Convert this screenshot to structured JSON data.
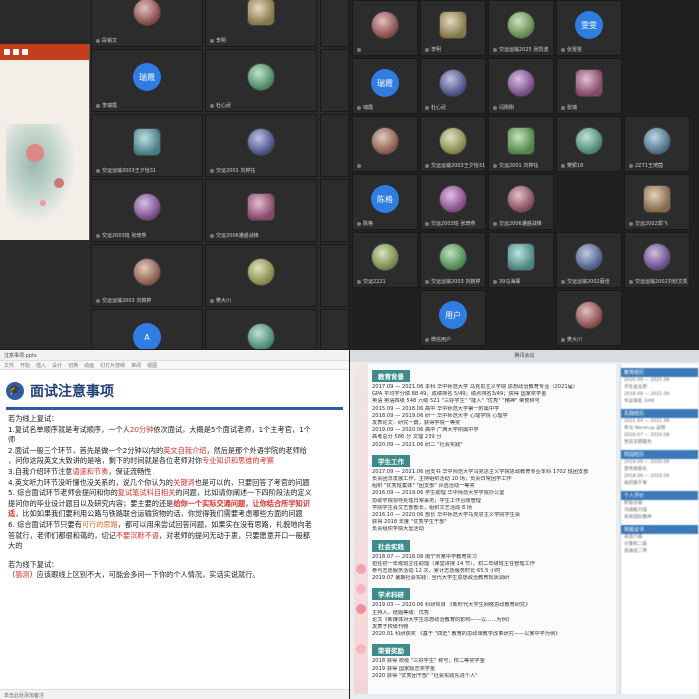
{
  "tl": {
    "tiles": [
      {
        "name": "段锡文",
        "avatar": "",
        "col": 1,
        "row": 0
      },
      {
        "name": "李明",
        "avatar": "",
        "col": 2,
        "row": 0
      },
      {
        "name": "李瑞霞",
        "avatar": "瑞霞",
        "col": 1,
        "row": 1
      },
      {
        "name": "杜心武",
        "avatar": "",
        "col": 2,
        "row": 1
      },
      {
        "name": "交运运输2003王夕怡31",
        "avatar": "",
        "col": 1,
        "row": 2
      },
      {
        "name": "交运2001 刘婷钰",
        "avatar": "",
        "col": 2,
        "row": 2
      },
      {
        "name": "交运2003班 张琦燕",
        "avatar": "",
        "col": 1,
        "row": 3
      },
      {
        "name": "交运2006潘盛战锋",
        "avatar": "",
        "col": 2,
        "row": 3
      },
      {
        "name": "交运运输2003 刘婉婷",
        "avatar": "",
        "col": 1,
        "row": 4
      },
      {
        "name": "樊大川",
        "avatar": "",
        "col": 2,
        "row": 4
      },
      {
        "name": "andes",
        "avatar": "A",
        "col": 1,
        "row": 5
      },
      {
        "name": "35刘丽琴",
        "avatar": "",
        "col": 2,
        "row": 5
      }
    ],
    "right_col": [
      "",
      "",
      "",
      "",
      "",
      ""
    ]
  },
  "tr": {
    "tiles": [
      {
        "name": "",
        "avatar": "",
        "col": 0,
        "row": 0
      },
      {
        "name": "李明",
        "avatar": "",
        "col": 1,
        "row": 0
      },
      {
        "name": "交运运输2025 张凯波",
        "avatar": "",
        "col": 2,
        "row": 0
      },
      {
        "name": "张雯雯",
        "avatar": "雯雯",
        "col": 3,
        "row": 0
      },
      {
        "name": "瑞霞",
        "avatar": "瑞霞",
        "col": 0,
        "row": 1
      },
      {
        "name": "杜心武",
        "avatar": "",
        "col": 1,
        "row": 1
      },
      {
        "name": "闫刚刚",
        "avatar": "",
        "col": 2,
        "row": 1
      },
      {
        "name": "张瑞",
        "avatar": "",
        "col": 3,
        "row": 1
      },
      {
        "name": "",
        "avatar": "",
        "col": 0,
        "row": 2
      },
      {
        "name": "交运运输2003王夕怡31",
        "avatar": "",
        "col": 1,
        "row": 2
      },
      {
        "name": "交运2001 刘婷钰",
        "avatar": "",
        "col": 2,
        "row": 2
      },
      {
        "name": "樊颖18",
        "avatar": "",
        "col": 3,
        "row": 2
      },
      {
        "name": "2Z71王琦茵",
        "avatar": "",
        "col": 4,
        "row": 2
      },
      {
        "name": "陈格",
        "avatar": "陈格",
        "col": 0,
        "row": 3
      },
      {
        "name": "交运2003班 张琦燕",
        "avatar": "",
        "col": 1,
        "row": 3
      },
      {
        "name": "交运2006潘盛战锋",
        "avatar": "",
        "col": 2,
        "row": 3
      },
      {
        "name": "交运2002郭飞",
        "avatar": "",
        "col": 4,
        "row": 3
      },
      {
        "name": "交运2221",
        "avatar": "",
        "col": 0,
        "row": 4
      },
      {
        "name": "交运运输2003 刘婉婷",
        "avatar": "",
        "col": 1,
        "row": 4
      },
      {
        "name": "39马海褰",
        "avatar": "",
        "col": 2,
        "row": 4
      },
      {
        "name": "交运运输2002蔡佳",
        "avatar": "",
        "col": 3,
        "row": 4
      },
      {
        "name": "交运运输2002刘欣文凯",
        "avatar": "",
        "col": 4,
        "row": 4
      },
      {
        "name": "微信用户",
        "avatar": "用户",
        "col": 1,
        "row": 5
      },
      {
        "name": "樊大川",
        "avatar": "",
        "col": 3,
        "row": 5
      }
    ]
  },
  "bl": {
    "file_name": "注意事项.pptx",
    "ribbon": [
      "文件",
      "开始",
      "插入",
      "设计",
      "切换",
      "动画",
      "幻灯片放映",
      "审阅",
      "视图"
    ],
    "title": "面试注意事项",
    "online_heading": "若为线上复试：",
    "lines": [
      {
        "parts": [
          [
            "1.复试名单顺序就是考试顺序，一个人",
            ""
          ],
          [
            "20分钟",
            "red"
          ],
          [
            "依次面试，大概是5个面试老师，1个主考官，1个",
            ""
          ]
        ]
      },
      {
        "parts": [
          [
            "师",
            ""
          ]
        ]
      },
      {
        "parts": [
          [
            "2.面试一般三个环节，首先是做一个2分钟以内的",
            ""
          ],
          [
            "英文自我介绍",
            "red"
          ],
          [
            "，然后是那个外语学院的老师给",
            ""
          ]
        ]
      },
      {
        "parts": [
          [
            "，问你这段英文大致讲的是啥，剩下的时间就是各位老师对你",
            ""
          ],
          [
            "专业知识和思维的考察",
            "red"
          ]
        ]
      },
      {
        "parts": [
          [
            "3.自我介绍环节注意",
            ""
          ],
          [
            "语速和节奏",
            "red"
          ],
          [
            "，保证流畅性",
            ""
          ]
        ]
      },
      {
        "parts": [
          [
            "4.英文听力环节没听懂也没关系的，说几个你认为的",
            ""
          ],
          [
            "关键词",
            "red"
          ],
          [
            "也是可以的，只要回答了考官的问题",
            ""
          ]
        ]
      },
      {
        "parts": [
          [
            "5. 综合面试环节老师会提问和你的",
            ""
          ],
          [
            "复试笔试科目相关",
            "red"
          ],
          [
            "的问题，比如请你阐述一下四阶段法的定义",
            ""
          ]
        ]
      },
      {
        "parts": [
          [
            "提问你的毕业设计题目以及研究内容；要主要的还是",
            ""
          ],
          [
            "给你一个实际交通问题，让你结合所学知识",
            "red bold"
          ]
        ]
      },
      {
        "parts": [
          [
            "适",
            "red bold"
          ],
          [
            "，比如如果我们要利用公路与铁路联合运输货物的话，你觉得我们需要考虑哪些方面的问题",
            ""
          ]
        ]
      },
      {
        "parts": [
          [
            "6. 综合面试环节只要有",
            ""
          ],
          [
            "可行的思路",
            "org"
          ],
          [
            "，都可以用来尝试回答问题，如果实在没有思路，礼貌地向老",
            ""
          ]
        ]
      },
      {
        "parts": [
          [
            "答就行，老师们都很和蔼的，切记",
            ""
          ],
          [
            "不要沉默不语",
            "red"
          ],
          [
            "，对老师的提问无动于衷，只要愿意开口一般都",
            ""
          ]
        ]
      },
      {
        "parts": [
          [
            "大的",
            ""
          ]
        ]
      }
    ],
    "offline_heading": "若为线下复试：",
    "offline_line": [
      [
        "（",
        ""
      ],
      [
        "猜测",
        "red"
      ],
      [
        "）应该跟线上区别不大，可能会多问一下你的个人情况，实话实说就行。",
        ""
      ]
    ],
    "footer": "单击此处添加备注"
  },
  "br": {
    "window_title": "腾讯会议",
    "sections": [
      {
        "heading": "教育背景",
        "lines": [
          "2017.09 — 2021.06  本科  华中师范大学  马克思主义学院  思想政治教育专业（2021届）",
          "GPA  平均学分绩 88.49，成绩排名 5/49；绩点排名3/49；获得 国家奖学金",
          "英语  英语四级 548 六级 521  \"三好学生\"  \"能人\"  \"优秀\"  \"精神\" 荣誉称号",
          "2015.09 — 2018.06  高中  华中师范大学第一附属中学",
          "2018.09 — 2019.06  研一  华中师范大学  心理学院  心理学",
          "  发表论文：研究一篇，获得学院一等奖",
          "2019.09 — 2020.06  高中  广西大学附属中学",
          "  高考总分 586 分  文理 239 分",
          "2020.09 — 2021.06  研二  \"社会实践\""
        ]
      },
      {
        "heading": "学生工作",
        "lines": [
          "2017.09 — 2021.06  团支书  华中师范大学马克思主义学院思政教育专业本科 1702 班团支部",
          "  负责团员发展工作，主持组织活动 10 场；负责日常团学工作",
          "  组织 \"优秀班集体\"  \"团支部\" 评选活动一等奖",
          "2016.09 — 2019.06  学生助理  华中师范大学学院办公室",
          "  协助学院领导处理日常事务；学生工作台账管理",
          "  学院学生会文艺部部长，组织文艺活动 8 场",
          "2016.10 — 2020.06  部长  华中师范大学马克思主义学院学生会",
          "  获得 2018 年度 \"优秀学生干部\"",
          "  负责组织学院大型活动"
        ]
      },
      {
        "heading": "社会实践",
        "lines": [
          "2018.07 — 2018.08  南宁市某中学教育实习",
          "  担任初一年级班主任助理（课堂讲授 14 节），初二年级班主任管理工作",
          "  参与志愿服务活动 12 次，累计志愿服务时长 65.5 小时",
          "2019.07  暑期社会实践：当代大学生思想政治教育现状调研"
        ]
      },
      {
        "heading": "学术科研",
        "lines": [
          "2019.03 — 2020.06  科研项目  《新时代大学生网络思政教育研究》",
          "  主持人，结题等级：优秀",
          "  论文《新媒体对大学生思想政治教育的影响——以……为例》",
          "  发表于校级刊物",
          "2020.01  科研获奖  《基于 \"四史\" 教育的思政课教学改革研究——以某中学为例》"
        ]
      },
      {
        "heading": "荣誉奖励",
        "lines": [
          "2018  获得 校级 \"三好学生\" 称号；校二等奖学金",
          "2019  获得 国家励志奖学金",
          "2020  获得 \"优秀团干部\"  \"社会实践先进个人\""
        ]
      }
    ],
    "side": [
      {
        "heading": "教育经历",
        "lines": [
          "2020.09 — 2021.06",
          "学生会主席",
          "2018.09 — 2021.06",
          "专业排名 3/48"
        ]
      },
      {
        "heading": "实践经历",
        "lines": [
          "2021.04 — 2021.06",
          "参与 Wordcup 运营",
          "2020.07 — 2020.08",
          "党员志愿服务"
        ]
      },
      {
        "heading": "校园经历",
        "lines": [
          "2019.09 — 2020.06",
          "宣传部部长",
          "2018.09 — 2019.06",
          "组织部干事"
        ]
      },
      {
        "heading": "个人评价",
        "lines": [
          "积极乐观",
          "沟通能力强",
          "具有团队精神"
        ]
      },
      {
        "heading": "技能证书",
        "lines": [
          "英语六级",
          "计算机二级",
          "普通话二甲"
        ]
      }
    ]
  }
}
